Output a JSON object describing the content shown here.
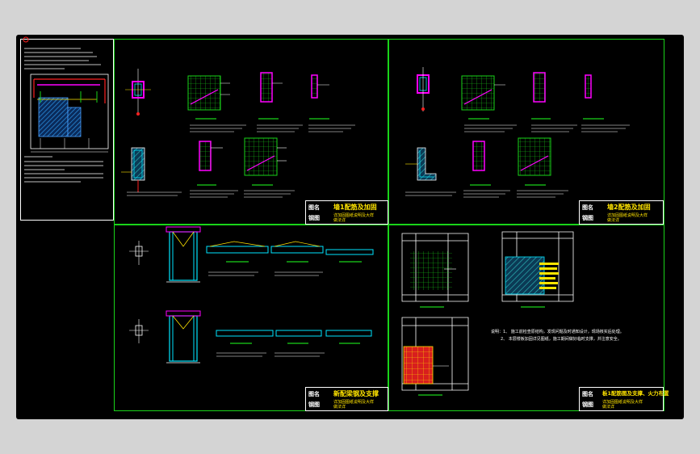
{
  "panels": {
    "top_left": {
      "title_label": "图名",
      "title": "墙1配筋及加固",
      "drawing_label": "钢图",
      "drawing_value": "详加固图纸说明及大样",
      "sub": "做法详"
    },
    "top_right": {
      "title_label": "图名",
      "title": "墙2配筋及加固",
      "drawing_label": "钢图",
      "drawing_value": "详加固图纸说明及大样",
      "sub": "做法详"
    },
    "bottom_left": {
      "title_label": "图名",
      "title": "新配梁钢及支撑",
      "drawing_label": "钢图",
      "drawing_value": "详加固图纸说明及大样",
      "sub": "做法详"
    },
    "bottom_right": {
      "title_label": "图名",
      "title": "板1配筋图及支撑、火力布置",
      "drawing_label": "钢图",
      "drawing_value": "详加固图纸说明及大样",
      "sub": "做法详"
    }
  },
  "notes": {
    "bottom_right_1": "说明：1、 施工前检查原结构，发现问题及时通知设计，现场核实后处理。",
    "bottom_right_2": "2、 本层楼板加固详见图纸，施工期间做好临时支撑，并注意安全。"
  },
  "colors": {
    "frame": "#19d419",
    "title": "#ffe400",
    "wall": "#ff00ff",
    "rebar": "#00e5ff",
    "fill_red": "#e02020",
    "hatch": "#1a6fbf"
  }
}
